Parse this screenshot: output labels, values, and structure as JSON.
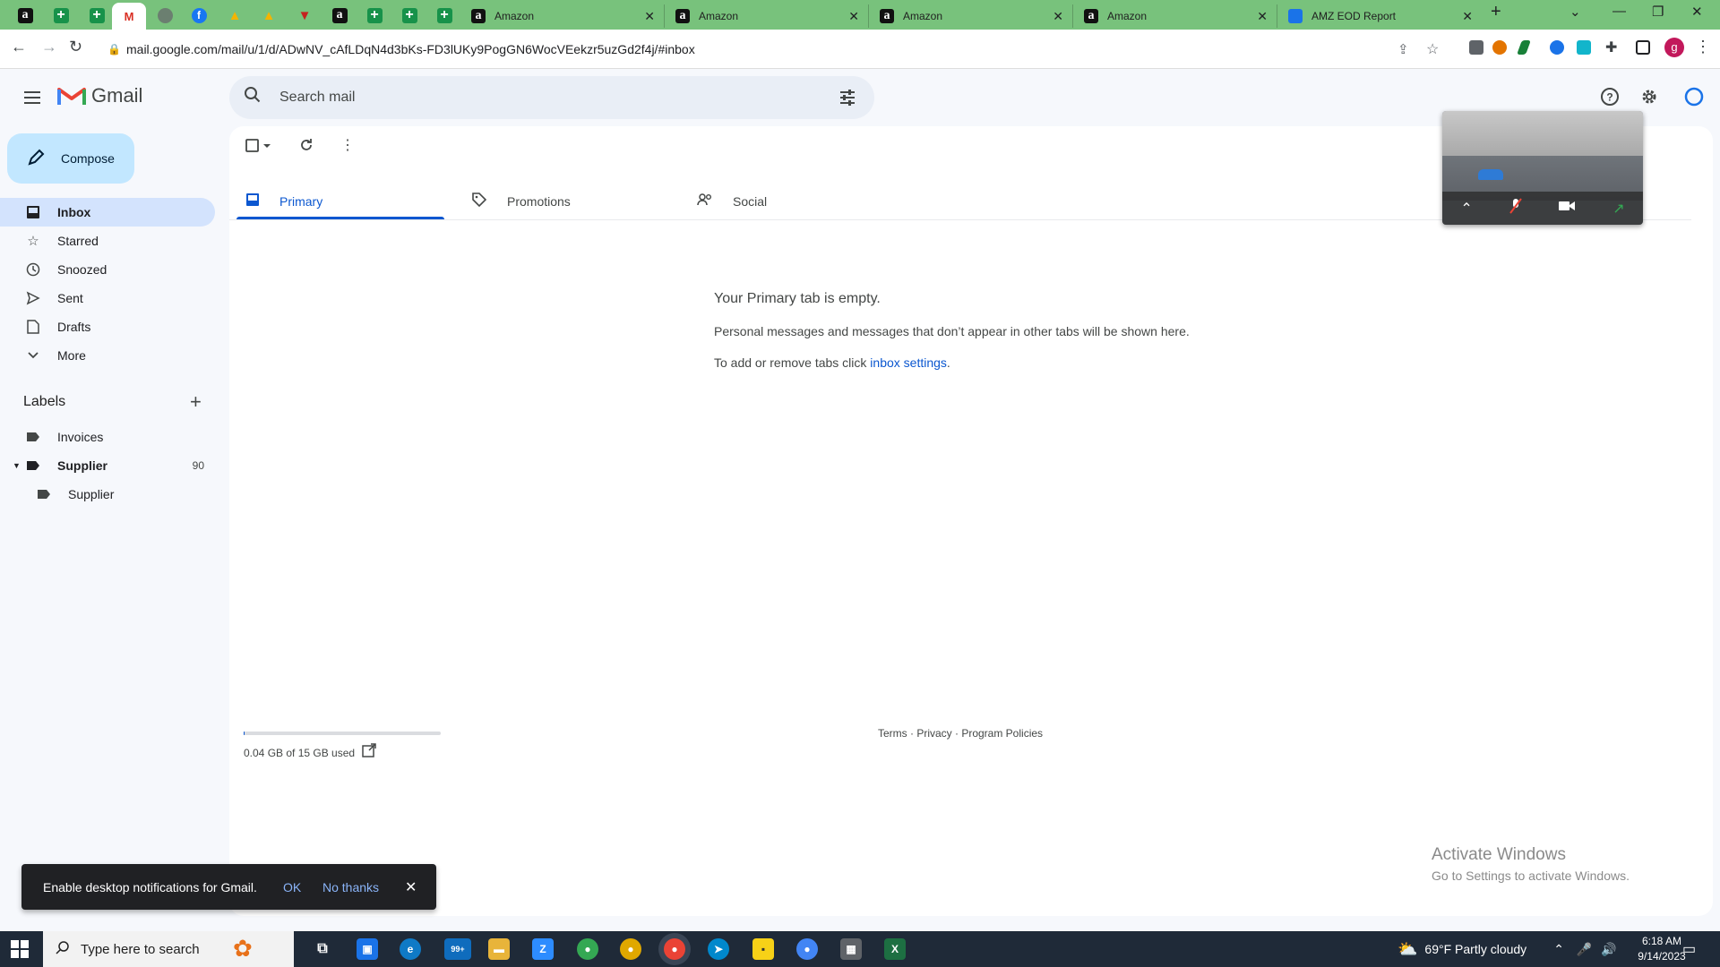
{
  "browser": {
    "tabs": [
      {
        "title": "Amazon",
        "icon": "amazon-icon"
      },
      {
        "title": "Amazon",
        "icon": "amazon-icon"
      },
      {
        "title": "Amazon",
        "icon": "amazon-icon"
      },
      {
        "title": "Amazon",
        "icon": "amazon-icon"
      },
      {
        "title": "AMZ EOD Report",
        "icon": "docs-icon"
      }
    ],
    "url": "mail.google.com/mail/u/1/d/ADwNV_cAfLDqN4d3bKs-FD3lUKy9PogGN6WocVEekzr5uzGd2f4j/#inbox",
    "profile_initial": "g"
  },
  "gmail": {
    "logo_text": "Gmail",
    "search_placeholder": "Search mail",
    "compose_label": "Compose",
    "nav": [
      {
        "label": "Inbox",
        "icon": "inbox-icon"
      },
      {
        "label": "Starred",
        "icon": "star-icon"
      },
      {
        "label": "Snoozed",
        "icon": "clock-icon"
      },
      {
        "label": "Sent",
        "icon": "send-icon"
      },
      {
        "label": "Drafts",
        "icon": "draft-icon"
      },
      {
        "label": "More",
        "icon": "chevron-down-icon"
      }
    ],
    "labels_heading": "Labels",
    "labels": [
      {
        "label": "Invoices",
        "count": ""
      },
      {
        "label": "Supplier",
        "count": "90"
      },
      {
        "label": "Supplier",
        "count": ""
      }
    ],
    "tabs": [
      {
        "label": "Primary"
      },
      {
        "label": "Promotions"
      },
      {
        "label": "Social"
      }
    ],
    "empty_title": "Your Primary tab is empty.",
    "empty_line1": "Personal messages and messages that don’t appear in other tabs will be shown here.",
    "empty_line2_prefix": "To add or remove tabs click ",
    "empty_line2_link": "inbox settings",
    "empty_line2_suffix": ".",
    "storage_text": "0.04 GB of 15 GB used",
    "storage_fraction": 0.003,
    "footer_links": "Terms · Privacy · Program Policies"
  },
  "snackbar": {
    "text": "Enable desktop notifications for Gmail.",
    "ok": "OK",
    "no_thanks": "No thanks"
  },
  "watermark": {
    "title": "Activate Windows",
    "subtitle": "Go to Settings to activate Windows."
  },
  "taskbar": {
    "search_placeholder": "Type here to search",
    "weather": "69°F  Partly cloudy",
    "time": "6:18 AM",
    "date": "9/14/2023",
    "mail_badge": "99+"
  },
  "colors": {
    "tabstrip": "#78c27c",
    "accent": "#0b57d0",
    "compose_bg": "#c2e7ff",
    "active_nav": "#d3e3fd"
  }
}
